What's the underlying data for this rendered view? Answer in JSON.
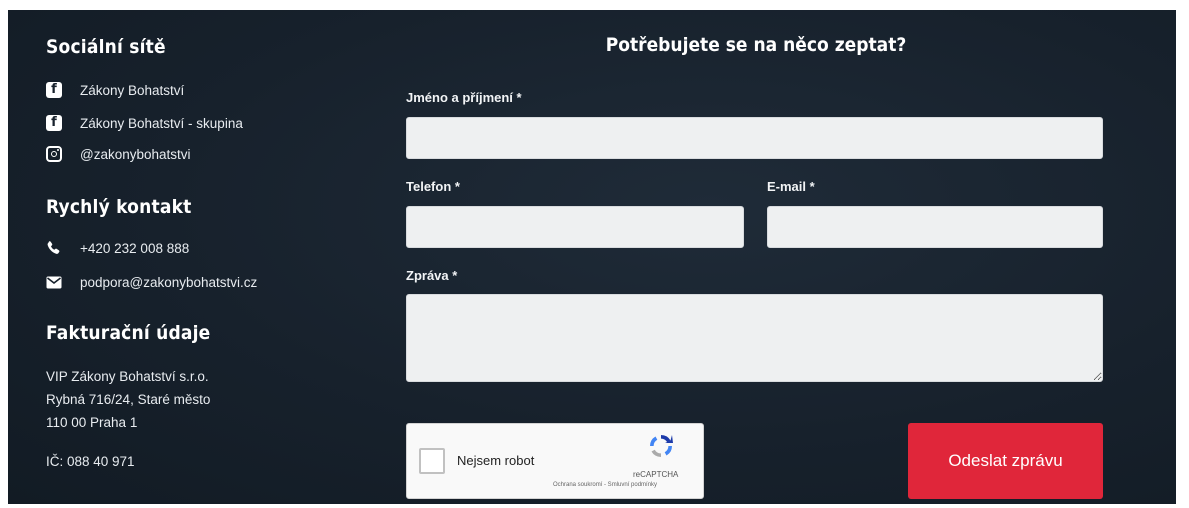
{
  "social": {
    "heading": "Sociální sítě",
    "items": [
      {
        "icon": "facebook-icon",
        "label": "Zákony Bohatství"
      },
      {
        "icon": "facebook-icon",
        "label": "Zákony Bohatství - skupina"
      },
      {
        "icon": "instagram-icon",
        "label": "@zakonybohatstvi"
      }
    ]
  },
  "contact": {
    "heading": "Rychlý kontakt",
    "phone": "+420 232 008 888",
    "email": "podpora@zakonybohatstvi.cz"
  },
  "billing": {
    "heading": "Fakturační údaje",
    "company": "VIP Zákony Bohatství s.r.o.",
    "street": "Rybná 716/24, Staré město",
    "city": "110 00 Praha 1",
    "ic": "IČ: 088 40 971"
  },
  "form": {
    "title": "Potřebujete se na něco zeptat?",
    "name_label": "Jméno a příjmení *",
    "name_value": "",
    "phone_label": "Telefon *",
    "phone_value": "",
    "email_label": "E-mail *",
    "email_value": "",
    "message_label": "Zpráva *",
    "message_value": "",
    "captcha_label": "Nejsem robot",
    "captcha_brand": "reCAPTCHA",
    "captcha_links": "Ochrana soukromí - Smluvní podmínky",
    "submit_label": "Odeslat zprávu"
  },
  "colors": {
    "background": "#17212c",
    "accent": "#e0263a",
    "input_bg": "#eef0f1"
  }
}
